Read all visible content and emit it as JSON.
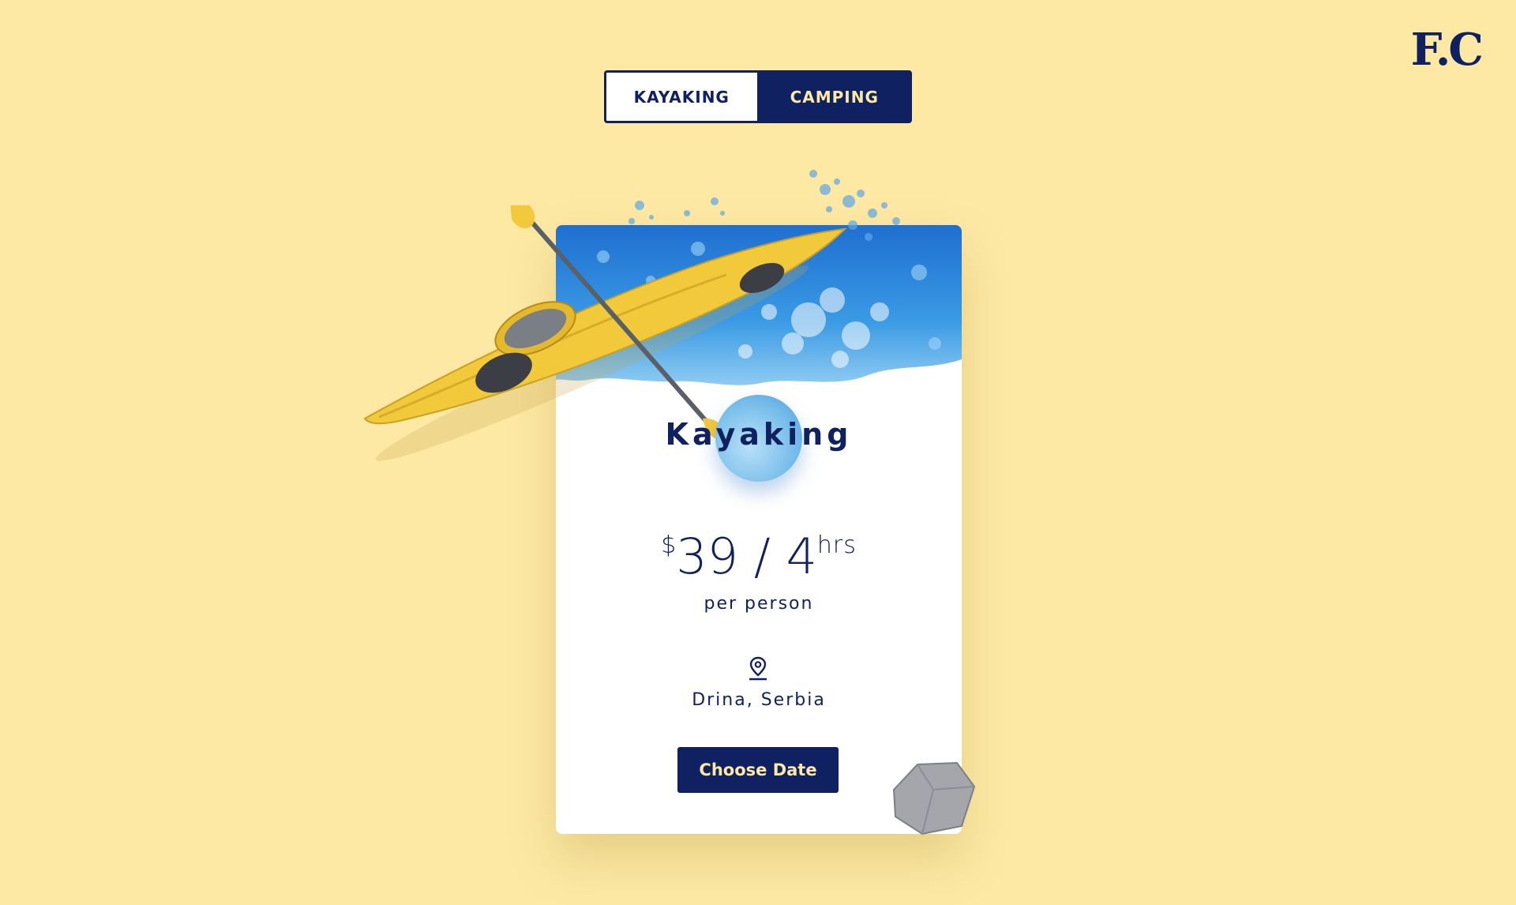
{
  "brand": {
    "logo_text": "F.C"
  },
  "tabs": [
    {
      "label": "KAYAKING",
      "active": true
    },
    {
      "label": "CAMPING",
      "active": false
    }
  ],
  "card": {
    "title": "Kayaking",
    "price": {
      "currency": "$",
      "amount": "39",
      "separator": "/",
      "duration": "4",
      "unit": "hrs"
    },
    "price_note": "per person",
    "location": "Drina, Serbia",
    "cta_label": "Choose Date"
  },
  "colors": {
    "background": "#fde9a4",
    "navy": "#0f2160",
    "water": "#2a7fd6",
    "kayak": "#f2c93a"
  },
  "icons": [
    "location-pin-icon"
  ]
}
